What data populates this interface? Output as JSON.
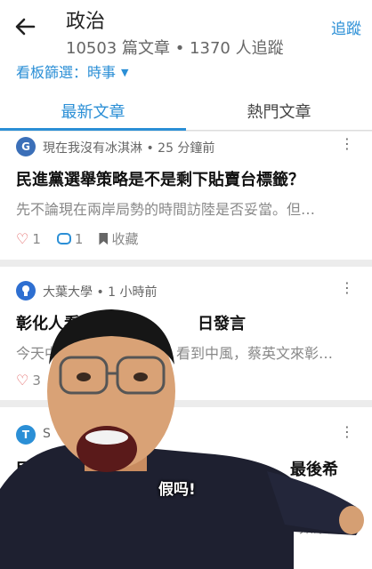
{
  "header": {
    "title": "政治",
    "subtitle": "10503 篇文章 • 1370 人追蹤",
    "follow_label": "追蹤",
    "filter_label": "看板篩選：時事"
  },
  "tabs": [
    {
      "label": "最新文章",
      "active": true
    },
    {
      "label": "熱門文章",
      "active": false
    }
  ],
  "posts": [
    {
      "avatar_letter": "G",
      "meta": "現在我沒有冰淇淋 • 25 分鐘前",
      "title": "民進黨選舉策略是不是剩下貼賣台標籤？",
      "excerpt": "先不論現在兩岸局勢的時間訪陸是否妥當。但…",
      "likes": "1",
      "comments": "1",
      "save_label": "收藏"
    },
    {
      "meta": "大葉大學 • 1 小時前",
      "title": "彰化人看",
      "title_tail": "日發言",
      "excerpt": "今天中",
      "excerpt_tail": "看到中風，蔡英文來彰…",
      "likes": "3"
    },
    {
      "avatar_letter": "T",
      "meta": "S",
      "title": "民",
      "title_tail": "最後希",
      "excerpt_tail": "」，如果是…"
    }
  ],
  "meme_caption": "假吗!",
  "colors": {
    "accent": "#2b8fd6",
    "heart": "#e05a5a"
  }
}
